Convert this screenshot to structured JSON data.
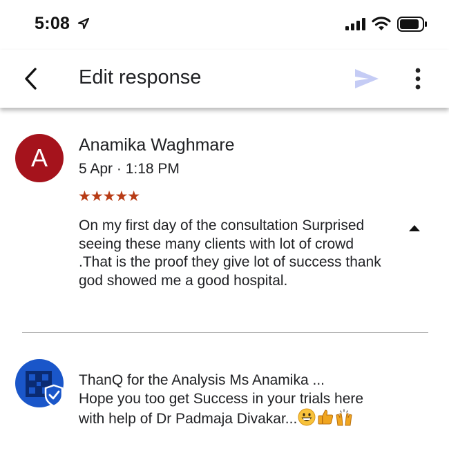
{
  "status_bar": {
    "time": "5:08"
  },
  "header": {
    "title": "Edit response",
    "icons": [
      "back-arrow-icon",
      "send-icon",
      "more-vert-icon"
    ]
  },
  "review": {
    "avatar_letter": "A",
    "reviewer_name": "Anamika Waghmare",
    "date": "5 Apr · 1:18 PM",
    "rating": 5,
    "stars": "★★★★★",
    "text": "On my first day of the consultation Surprised seeing these many clients with lot of crowd .That is the proof they give lot of success thank god showed me a good hospital."
  },
  "response": {
    "lines": [
      "ThanQ for the Analysis Ms Anamika ...",
      "Hope you too get Success in your trials here",
      "with help of Dr Padmaja Divakar..."
    ],
    "emojis": [
      "grinning-face-icon",
      "thumbs-up-icon",
      "raising-hands-icon"
    ]
  },
  "colors": {
    "avatar_bg": "#a5131c",
    "star_color": "#b83c16",
    "send_icon": "#c5ccf5",
    "owner_avatar_bg": "#1a56c9"
  }
}
